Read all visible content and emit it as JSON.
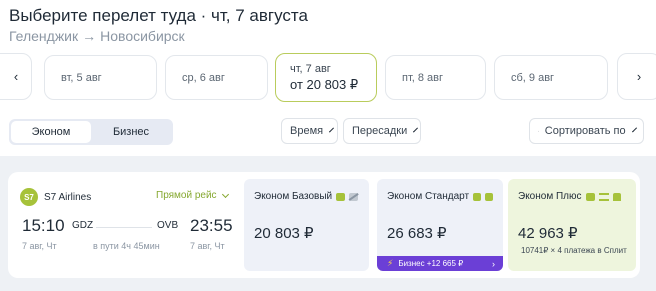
{
  "header": {
    "title": "Выберите перелет туда · чт, 7 августа",
    "origin": "Геленджик",
    "arrow": "→",
    "destination": "Новосибирск"
  },
  "date_strip": {
    "prev_icon": "‹",
    "next_icon": "›",
    "dates": [
      {
        "label": "вт, 5 авг"
      },
      {
        "label": "ср, 6 авг"
      },
      {
        "label": "чт, 7 авг",
        "price": "от 20 803 ₽",
        "selected": true
      },
      {
        "label": "пт, 8 авг"
      },
      {
        "label": "сб, 9 авг"
      }
    ]
  },
  "cabin": {
    "economy": "Эконом",
    "business": "Бизнес",
    "selected": "economy"
  },
  "filters": {
    "time": "Время",
    "transfers": "Пересадки",
    "sort": "Сортировать по"
  },
  "flight": {
    "airline": "S7 Airlines",
    "logo_text": "S7",
    "direct": "Прямой рейс",
    "dep_time": "15:10",
    "dep_code": "GDZ",
    "dep_date": "7 авг, Чт",
    "arr_time": "23:55",
    "arr_code": "OVB",
    "arr_date": "7 авг, Чт",
    "duration": "в пути 4ч 45мин",
    "fares": {
      "basic": {
        "name": "Эконом Базовый",
        "price": "20 803 ₽"
      },
      "standard": {
        "name": "Эконом Стандарт",
        "price": "26 683 ₽",
        "upsell": "Бизнес +12 665 ₽",
        "upsell_arrow": "›"
      },
      "plus": {
        "name": "Эконом Плюс",
        "price": "42 963 ₽",
        "split": "10741₽ × 4 платежа в Сплит"
      }
    }
  },
  "colors": {
    "accent_green": "#a6c23a",
    "business_purple": "#6b3fd6",
    "selected_border": "#b9cc5c"
  }
}
